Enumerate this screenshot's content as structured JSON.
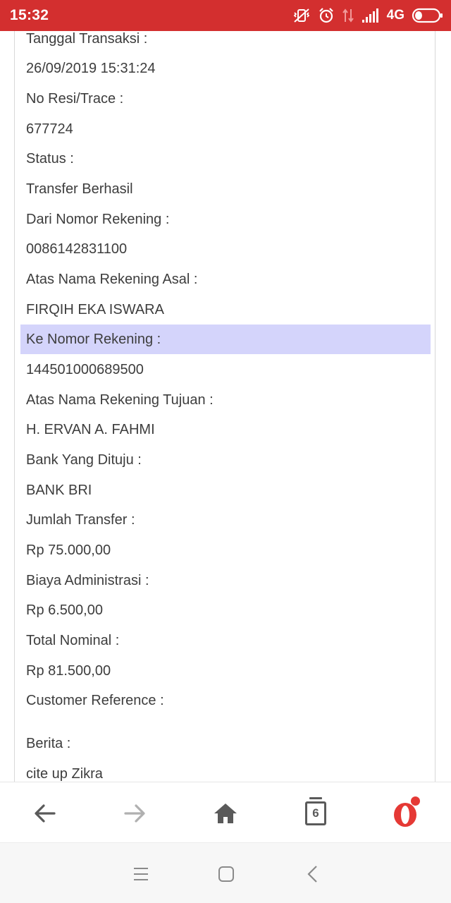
{
  "status_bar": {
    "time": "15:32",
    "network": "4G",
    "icons": [
      "vibrate-off-icon",
      "alarm-icon",
      "data-transfer-icon",
      "signal-icon",
      "battery-icon"
    ]
  },
  "details": [
    {
      "text": "Tanggal Transaksi :",
      "highlight": false
    },
    {
      "text": "26/09/2019 15:31:24",
      "highlight": false
    },
    {
      "text": "No Resi/Trace :",
      "highlight": false
    },
    {
      "text": "677724",
      "highlight": false
    },
    {
      "text": "Status :",
      "highlight": false
    },
    {
      "text": "Transfer Berhasil",
      "highlight": false
    },
    {
      "text": "Dari Nomor Rekening :",
      "highlight": false
    },
    {
      "text": "0086142831100",
      "highlight": false
    },
    {
      "text": "Atas Nama Rekening Asal :",
      "highlight": false
    },
    {
      "text": "FIRQIH EKA ISWARA",
      "highlight": false
    },
    {
      "text": "Ke Nomor Rekening :",
      "highlight": true
    },
    {
      "text": "144501000689500",
      "highlight": false
    },
    {
      "text": "Atas Nama Rekening Tujuan :",
      "highlight": false
    },
    {
      "text": "H. ERVAN A. FAHMI",
      "highlight": false
    },
    {
      "text": "Bank Yang Dituju :",
      "highlight": false
    },
    {
      "text": "BANK BRI",
      "highlight": false
    },
    {
      "text": "Jumlah Transfer :",
      "highlight": false
    },
    {
      "text": "Rp 75.000,00",
      "highlight": false
    },
    {
      "text": "Biaya Administrasi :",
      "highlight": false
    },
    {
      "text": "Rp 6.500,00",
      "highlight": false
    },
    {
      "text": "Total Nominal :",
      "highlight": false
    },
    {
      "text": "Rp 81.500,00",
      "highlight": false
    },
    {
      "text": "Customer Reference :",
      "highlight": false
    },
    {
      "text": "",
      "highlight": false
    },
    {
      "text": "Berita :",
      "highlight": false
    },
    {
      "text": "cite up Zikra",
      "highlight": false
    }
  ],
  "browser_bar": {
    "tab_count": "6",
    "colors": {
      "icon": "#5a5a5a",
      "icon_disabled": "#b0b0b0",
      "opera_red": "#e53935"
    }
  },
  "colors": {
    "status_bar": "#d32f2f",
    "highlight_row": "#d4d4fb",
    "text": "#3d3d3d"
  }
}
